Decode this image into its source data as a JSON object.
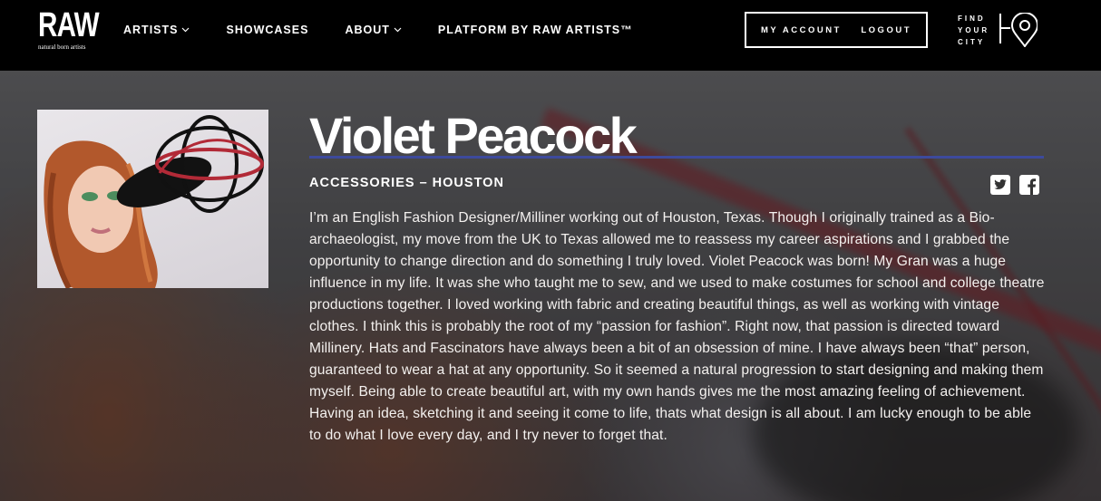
{
  "header": {
    "logo": {
      "main": "RAW",
      "tagline": "natural born artists"
    },
    "nav": [
      {
        "label": "ARTISTS",
        "has_dropdown": true
      },
      {
        "label": "SHOWCASES",
        "has_dropdown": false
      },
      {
        "label": "ABOUT",
        "has_dropdown": true
      },
      {
        "label": "PLATFORM BY RAW ARTISTS™",
        "has_dropdown": false
      }
    ],
    "account": {
      "my_account_label": "MY ACCOUNT",
      "logout_label": "LOGOUT"
    },
    "find_city": {
      "line1": "FIND",
      "line2": "YOUR",
      "line3": "CITY",
      "icon": "location-pin-icon"
    }
  },
  "profile": {
    "name": "Violet Peacock",
    "category": "ACCESSORIES – HOUSTON",
    "accent_color": "#3d4a9c",
    "social": [
      {
        "icon": "twitter-icon"
      },
      {
        "icon": "facebook-icon"
      }
    ],
    "bio": "I’m an English Fashion Designer/Milliner working out of Houston, Texas. Though I originally trained as a Bio-archaeologist, my move from the UK to Texas allowed me to reassess my career aspirations and I grabbed the opportunity to change direction and do something I truly loved. Violet Peacock was born! My Gran was a huge influence in my life. It was she who taught me to sew, and we used to make costumes for school and college theatre productions together. I loved working with fabric and creating beautiful things, as well as working with vintage clothes. I think this is probably the root of my “passion for fashion”. Right now, that passion is directed toward Millinery. Hats and Fascinators have always been a bit of an obsession of mine. I have always been “that” person, guaranteed to wear a hat at any opportunity. So it seemed a natural progression to start designing and making them myself. Being able to create beautiful art, with my own hands gives me the most amazing feeling of achievement. Having an idea, sketching it and seeing it come to life, thats what design is all about. I am lucky enough to be able to do what I love every day, and I try never to forget that."
  }
}
